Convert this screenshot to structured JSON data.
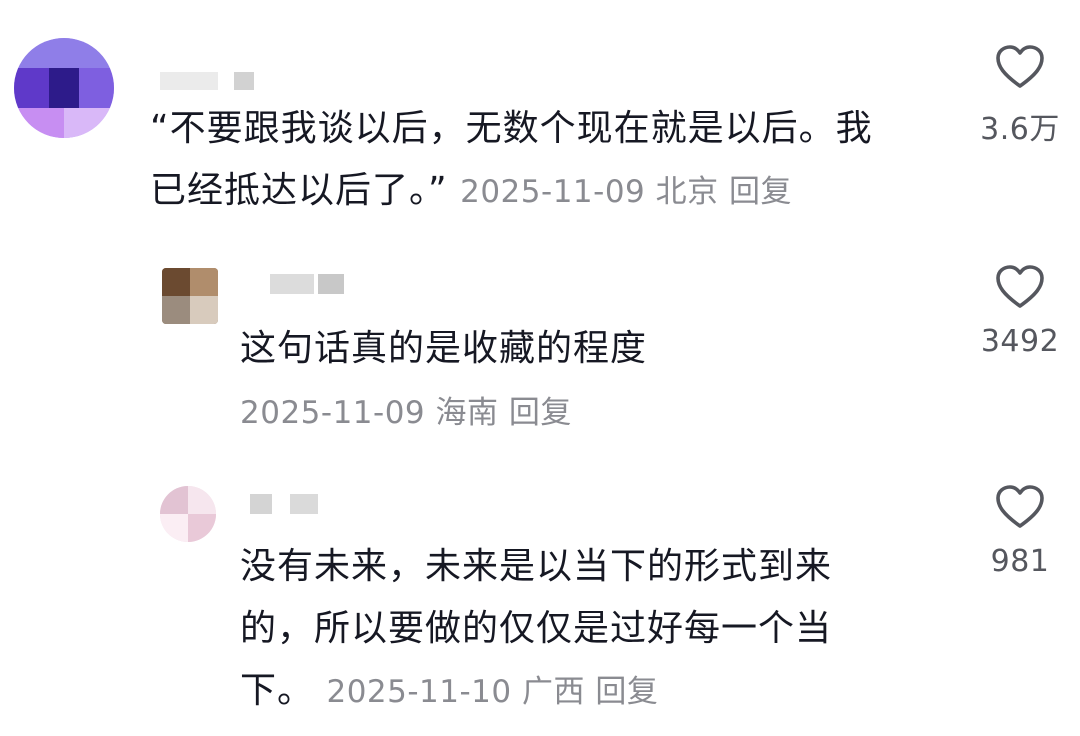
{
  "comments": [
    {
      "text_line1": "“不要跟我谈以后，无数个现在就是以后。我",
      "text_line2": "已经抵达以后了。”",
      "date": "2025-11-09",
      "location": "北京",
      "reply_label": "回复",
      "likes": "3.6万",
      "like_icon": "heart-outline-icon"
    },
    {
      "text_line1": "这句话真的是收藏的程度",
      "date": "2025-11-09",
      "location": "海南",
      "reply_label": "回复",
      "likes": "3492",
      "like_icon": "heart-outline-icon"
    },
    {
      "text_line1": "没有未来，未来是以当下的形式到来",
      "text_line2": "的，所以要做的仅仅是过好每一个当",
      "text_line3": "下。",
      "date": "2025-11-10",
      "location": "广西",
      "reply_label": "回复",
      "likes": "981",
      "like_icon": "heart-outline-icon"
    }
  ]
}
